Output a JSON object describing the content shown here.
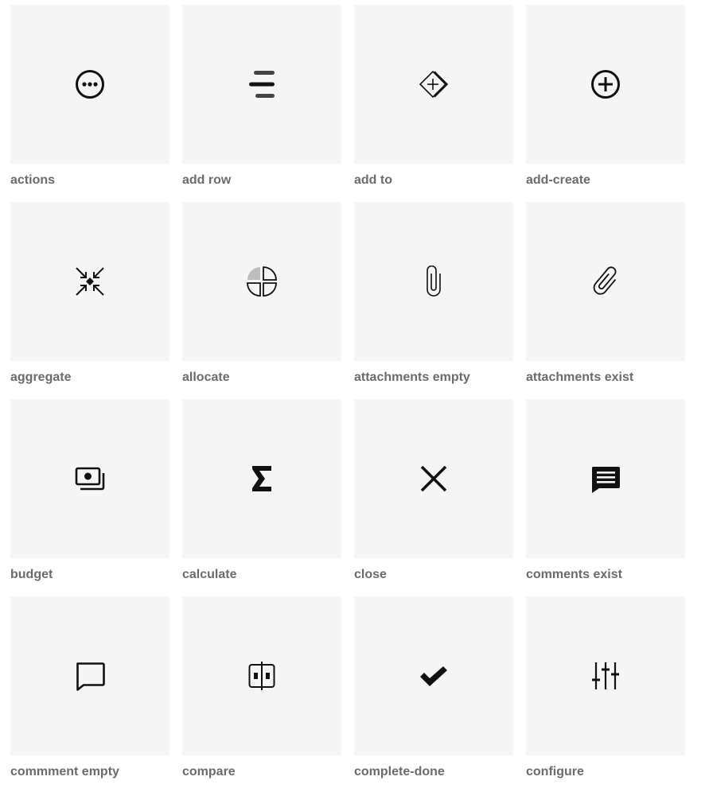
{
  "icons": [
    {
      "label": "actions",
      "icon": "actions-icon"
    },
    {
      "label": "add row",
      "icon": "add-row-icon"
    },
    {
      "label": "add to",
      "icon": "add-to-icon"
    },
    {
      "label": "add-create",
      "icon": "add-create-icon"
    },
    {
      "label": "aggregate",
      "icon": "aggregate-icon"
    },
    {
      "label": "allocate",
      "icon": "allocate-icon"
    },
    {
      "label": "attachments empty",
      "icon": "attachments-empty-icon"
    },
    {
      "label": "attachments exist",
      "icon": "attachments-exist-icon"
    },
    {
      "label": "budget",
      "icon": "budget-icon"
    },
    {
      "label": "calculate",
      "icon": "calculate-icon"
    },
    {
      "label": "close",
      "icon": "close-icon"
    },
    {
      "label": "comments exist",
      "icon": "comments-exist-icon"
    },
    {
      "label": "commment empty",
      "icon": "comment-empty-icon"
    },
    {
      "label": "compare",
      "icon": "compare-icon"
    },
    {
      "label": "complete-done",
      "icon": "complete-done-icon"
    },
    {
      "label": "configure",
      "icon": "configure-icon"
    }
  ]
}
